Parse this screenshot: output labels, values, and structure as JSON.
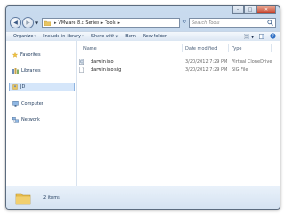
{
  "address": {
    "crumbs": [
      "VMware 8.x Series",
      "Tools"
    ]
  },
  "search": {
    "placeholder": "Search Tools"
  },
  "toolbar": {
    "organize": "Organize",
    "include_in_library": "Include in library",
    "share_with": "Share with",
    "burn": "Burn",
    "new_folder": "New folder"
  },
  "sidebar": {
    "favorites": "Favorites",
    "libraries": "Libraries",
    "user": "JD",
    "computer": "Computer",
    "network": "Network"
  },
  "columns": {
    "name": "Name",
    "date_modified": "Date modified",
    "type": "Type"
  },
  "files": [
    {
      "name": "darwin.iso",
      "date": "3/20/2012 7:29 PM",
      "type": "Virtual CloneDrive",
      "icon": "disc-image-icon"
    },
    {
      "name": "darwin.iso.sig",
      "date": "3/20/2012 7:29 PM",
      "type": "SIG File",
      "icon": "generic-file-icon"
    }
  ],
  "status": {
    "item_count": "2 items"
  },
  "colors": {
    "window_frame": "#c9dbee",
    "selection": "#d5e6fa",
    "folder": "#e8c562",
    "close_button": "#c4402a"
  }
}
